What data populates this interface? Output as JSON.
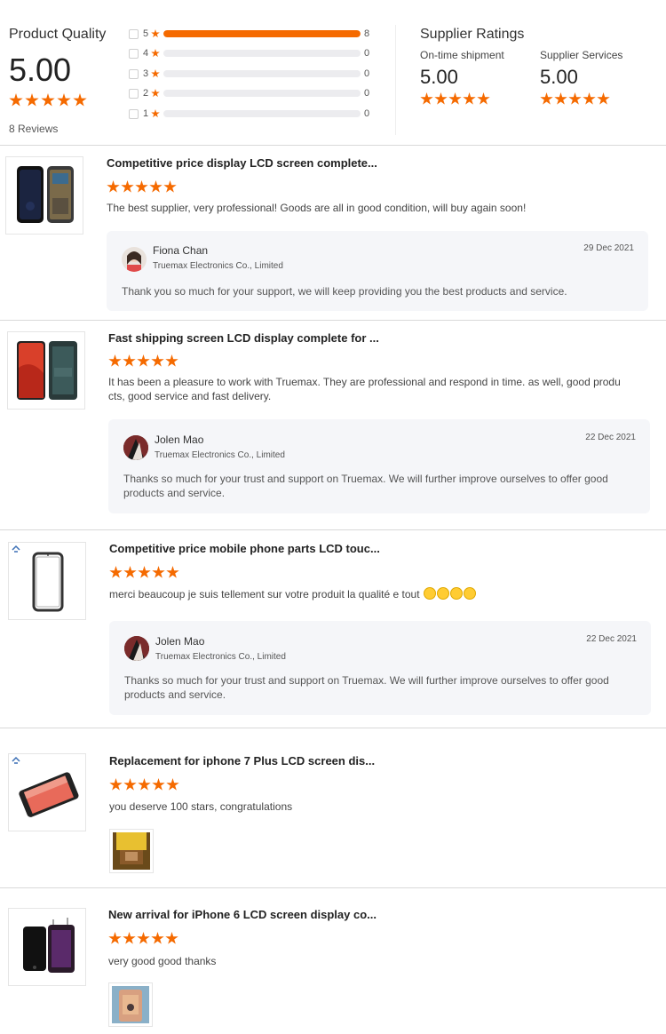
{
  "product_quality": {
    "title": "Product Quality",
    "score": "5.00",
    "reviews_count": "8 Reviews",
    "distribution": [
      {
        "stars": "5",
        "count": "8",
        "fraction": 1.0
      },
      {
        "stars": "4",
        "count": "0",
        "fraction": 0
      },
      {
        "stars": "3",
        "count": "0",
        "fraction": 0
      },
      {
        "stars": "2",
        "count": "0",
        "fraction": 0
      },
      {
        "stars": "1",
        "count": "0",
        "fraction": 0
      }
    ]
  },
  "supplier_ratings": {
    "title": "Supplier Ratings",
    "ontime_label": "On-time shipment",
    "ontime_score": "5.00",
    "services_label": "Supplier Services",
    "services_score": "5.00"
  },
  "colors": {
    "accent": "#f56a00"
  },
  "reviews": [
    {
      "title": "Competitive price display LCD screen complete...",
      "rating": 5,
      "text": "The best supplier, very professional! Goods are all in good condition, will buy again soon!",
      "reply": {
        "name": "Fiona Chan",
        "company": "Truemax Electronics Co., Limited",
        "date": "29 Dec 2021",
        "text": "Thank you so much for your support, we will keep providing you the best products and service."
      }
    },
    {
      "title": "Fast shipping screen LCD display complete for ...",
      "rating": 5,
      "text": "It has been a pleasure to work with Truemax. They are professional and respond in time. as well, good products, good service and fast delivery.",
      "reply": {
        "name": "Jolen Mao",
        "company": "Truemax Electronics Co., Limited",
        "date": "22 Dec 2021",
        "text": "Thanks so much for your trust and support on Truemax. We will further improve ourselves to offer good products and service."
      }
    },
    {
      "title": "Competitive price mobile phone parts LCD touc...",
      "rating": 5,
      "text": "merci beaucoup je suis tellement sur votre produit la qualité e tout",
      "reply": {
        "name": "Jolen Mao",
        "company": "Truemax Electronics Co., Limited",
        "date": "22 Dec 2021",
        "text": "Thanks so much for your trust and support on Truemax. We will further improve ourselves to offer good products and service."
      }
    },
    {
      "title": "Replacement for iphone 7 Plus LCD screen dis...",
      "rating": 5,
      "text": "you deserve 100 stars, congratulations"
    },
    {
      "title": "New arrival for iPhone 6 LCD screen display co...",
      "rating": 5,
      "text": "very good good thanks"
    }
  ]
}
